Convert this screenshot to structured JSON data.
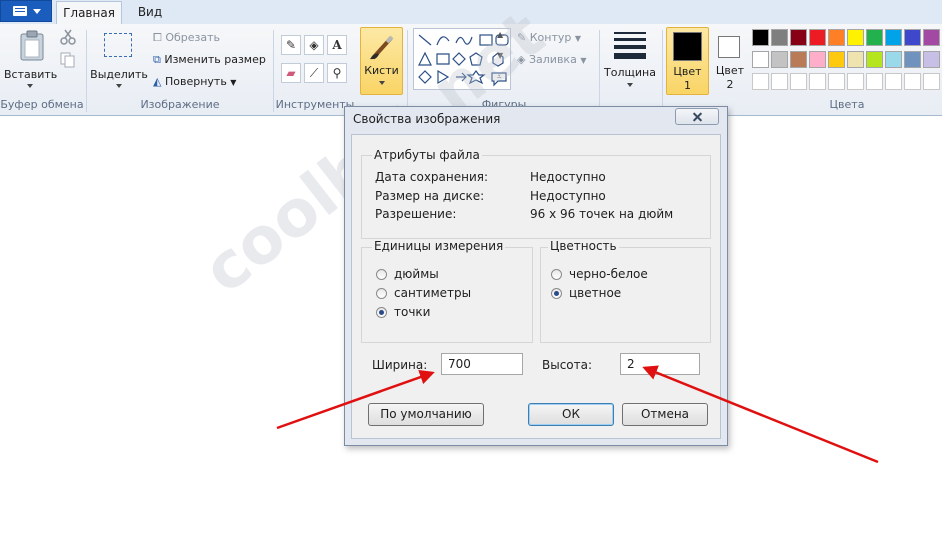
{
  "tabs": {
    "home": "Главная",
    "view": "Вид"
  },
  "ribbon": {
    "clipboard": {
      "paste": "Вставить",
      "group": "Буфер обмена"
    },
    "image": {
      "select": "Выделить",
      "crop": "Обрезать",
      "resize": "Изменить размер",
      "rotate": "Повернуть",
      "group": "Изображение"
    },
    "tools": {
      "group": "Инструменты",
      "text_tool": "A"
    },
    "brushes": {
      "label": "Кисти"
    },
    "shapes": {
      "outline": "Контур",
      "fill": "Заливка",
      "group": "Фигуры"
    },
    "size": {
      "label": "Толщина"
    },
    "color1": {
      "label_line1": "Цвет",
      "label_line2": "1",
      "value": "#000000"
    },
    "color2": {
      "label_line1": "Цвет",
      "label_line2": "2",
      "value": "#ffffff"
    },
    "colors": {
      "group": "Цвета",
      "row1": [
        "#000000",
        "#7f7f7f",
        "#880015",
        "#ed1c24",
        "#ff7f27",
        "#fff200",
        "#22b14c",
        "#00a2e8",
        "#3f48cc",
        "#a349a4"
      ],
      "row2": [
        "#ffffff",
        "#c3c3c3",
        "#b97a57",
        "#ffaec9",
        "#ffc90e",
        "#efe4b0",
        "#b5e61d",
        "#99d9ea",
        "#7092be",
        "#c8bfe7"
      ]
    }
  },
  "watermark": "coolbyt.net",
  "dialog": {
    "title": "Свойства изображения",
    "file_attributes": {
      "title": "Атрибуты файла",
      "rows": [
        {
          "label": "Дата сохранения:",
          "value": "Недоступно"
        },
        {
          "label": "Размер на диске:",
          "value": "Недоступно"
        },
        {
          "label": "Разрешение:",
          "value": "96 x 96 точек на дюйм"
        }
      ]
    },
    "units": {
      "title": "Единицы измерения",
      "options": [
        "дюймы",
        "сантиметры",
        "точки"
      ],
      "selected": "точки"
    },
    "colors": {
      "title": "Цветность",
      "options": [
        "черно-белое",
        "цветное"
      ],
      "selected": "цветное"
    },
    "width": {
      "label": "Ширина:",
      "value": "700"
    },
    "height": {
      "label": "Высота:",
      "value": "2"
    },
    "buttons": {
      "default": "По умолчанию",
      "ok": "ОК",
      "cancel": "Отмена"
    }
  },
  "annotation_color": "#e01010"
}
